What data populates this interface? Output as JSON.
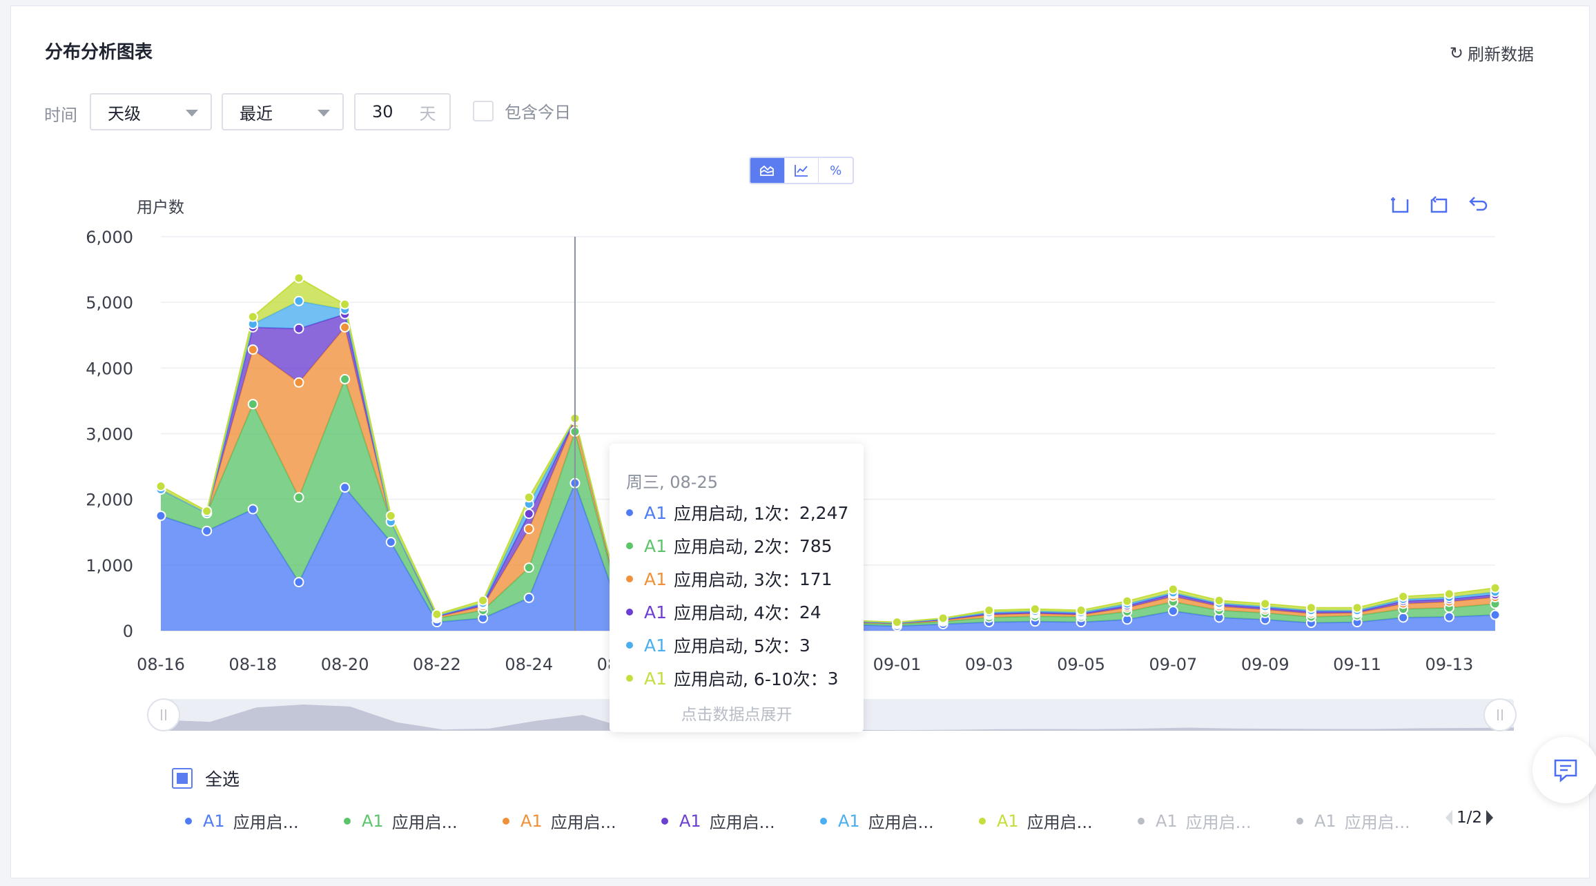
{
  "page": {
    "title": "分布分析图表",
    "refresh_label": "刷新数据",
    "time_label": "时间",
    "granularity": "天级",
    "range_mode": "最近",
    "range_value": "30",
    "range_unit": "天",
    "include_today": "包含今日",
    "view_toggle": {
      "area": "area-chart-icon",
      "line": "line-chart-icon",
      "percent": "%"
    },
    "select_all": "全选",
    "pager": "1/2"
  },
  "colors": {
    "s1": "#4e7cf6",
    "s2": "#5cc46b",
    "s3": "#f0913a",
    "s4": "#6a3fd1",
    "s5": "#4aaef0",
    "s6": "#c3de3d",
    "grey": "#b9bdc6",
    "accent": "#4e6ef2"
  },
  "tooltip": {
    "date": "周三, 08-25",
    "rows": [
      {
        "tag": "A1",
        "label": "应用启动, 1次",
        "value": "2,247",
        "color": "#4e7cf6"
      },
      {
        "tag": "A1",
        "label": "应用启动, 2次",
        "value": "785",
        "color": "#5cc46b"
      },
      {
        "tag": "A1",
        "label": "应用启动, 3次",
        "value": "171",
        "color": "#f0913a"
      },
      {
        "tag": "A1",
        "label": "应用启动, 4次",
        "value": "24",
        "color": "#6a3fd1"
      },
      {
        "tag": "A1",
        "label": "应用启动, 5次",
        "value": "3",
        "color": "#4aaef0"
      },
      {
        "tag": "A1",
        "label": "应用启动, 6-10次",
        "value": "3",
        "color": "#c3de3d"
      }
    ],
    "hint": "点击数据点展开"
  },
  "legend": [
    {
      "tag": "A1",
      "label": "应用启...",
      "color": "#4e7cf6",
      "active": true
    },
    {
      "tag": "A1",
      "label": "应用启...",
      "color": "#5cc46b",
      "active": true
    },
    {
      "tag": "A1",
      "label": "应用启...",
      "color": "#f0913a",
      "active": true
    },
    {
      "tag": "A1",
      "label": "应用启...",
      "color": "#6a3fd1",
      "active": true
    },
    {
      "tag": "A1",
      "label": "应用启...",
      "color": "#4aaef0",
      "active": true
    },
    {
      "tag": "A1",
      "label": "应用启...",
      "color": "#c3de3d",
      "active": true
    },
    {
      "tag": "A1",
      "label": "应用启...",
      "color": "#b9bdc6",
      "active": false
    },
    {
      "tag": "A1",
      "label": "应用启...",
      "color": "#b9bdc6",
      "active": false
    }
  ],
  "chart_data": {
    "type": "area",
    "stacked": true,
    "ylabel": "用户数",
    "ylim": [
      0,
      6000
    ],
    "yticks": [
      0,
      1000,
      2000,
      3000,
      4000,
      5000,
      6000
    ],
    "x": [
      "08-16",
      "08-17",
      "08-18",
      "08-19",
      "08-20",
      "08-21",
      "08-22",
      "08-23",
      "08-24",
      "08-25",
      "08-26",
      "08-27",
      "08-28",
      "08-29",
      "08-30",
      "08-31",
      "09-01",
      "09-02",
      "09-03",
      "09-04",
      "09-05",
      "09-06",
      "09-07",
      "09-08",
      "09-09",
      "09-10",
      "09-11",
      "09-12",
      "09-13",
      "09-14"
    ],
    "xtick_labels": [
      "08-16",
      "08-18",
      "08-20",
      "08-22",
      "08-24",
      "08-26",
      "08-28",
      "08-30",
      "09-01",
      "09-03",
      "09-05",
      "09-07",
      "09-09",
      "09-11",
      "09-13"
    ],
    "crosshair_x": "08-25",
    "series": [
      {
        "values": [
          1750,
          1520,
          1850,
          740,
          2180,
          1350,
          130,
          190,
          500,
          2247,
          250,
          180,
          150,
          120,
          110,
          90,
          70,
          100,
          130,
          140,
          130,
          170,
          300,
          200,
          170,
          120,
          130,
          200,
          210,
          240
        ]
      },
      {
        "values": [
          400,
          270,
          1600,
          1290,
          1650,
          310,
          60,
          120,
          460,
          785,
          90,
          70,
          60,
          50,
          40,
          30,
          30,
          40,
          70,
          80,
          80,
          120,
          140,
          110,
          100,
          90,
          100,
          130,
          140,
          170
        ]
      },
      {
        "values": [
          0,
          0,
          830,
          1750,
          790,
          0,
          20,
          60,
          590,
          171,
          30,
          30,
          20,
          20,
          10,
          10,
          10,
          20,
          40,
          40,
          30,
          60,
          80,
          60,
          50,
          50,
          40,
          80,
          90,
          100
        ]
      },
      {
        "values": [
          0,
          0,
          340,
          820,
          200,
          0,
          10,
          30,
          230,
          24,
          10,
          10,
          10,
          10,
          10,
          10,
          5,
          10,
          20,
          20,
          20,
          30,
          40,
          30,
          30,
          30,
          20,
          40,
          40,
          40
        ]
      },
      {
        "values": [
          0,
          0,
          50,
          420,
          70,
          0,
          10,
          20,
          150,
          3,
          10,
          10,
          10,
          10,
          10,
          5,
          5,
          10,
          20,
          20,
          20,
          30,
          20,
          20,
          20,
          20,
          20,
          30,
          30,
          40
        ]
      },
      {
        "values": [
          50,
          30,
          110,
          350,
          80,
          90,
          20,
          40,
          100,
          3,
          20,
          20,
          20,
          20,
          20,
          10,
          10,
          10,
          30,
          30,
          30,
          40,
          50,
          40,
          40,
          40,
          40,
          40,
          50,
          60
        ]
      }
    ]
  }
}
